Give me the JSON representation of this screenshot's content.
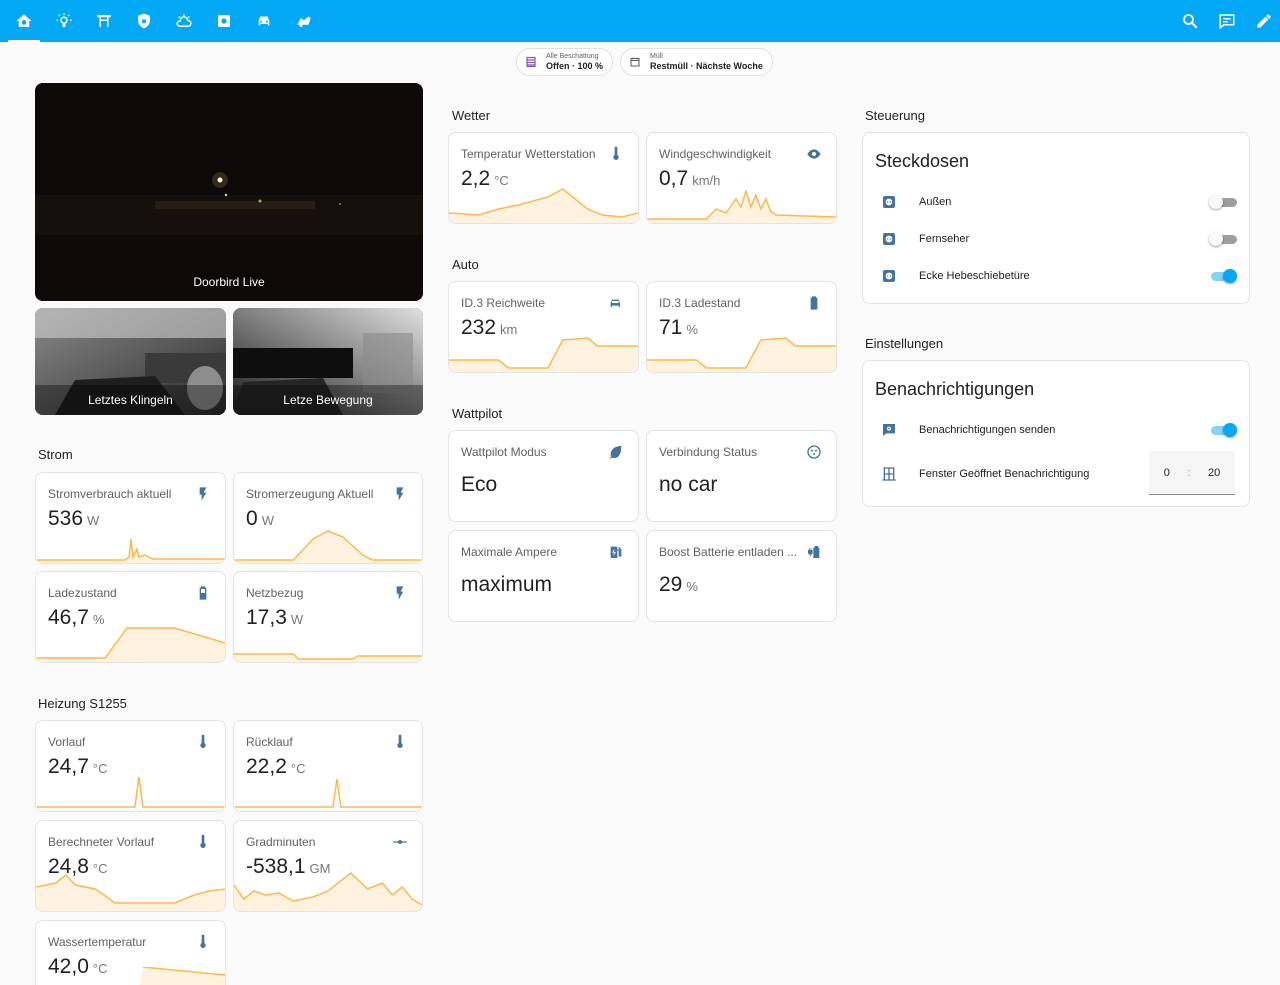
{
  "nav": {
    "tabs": [
      {
        "name": "home-icon"
      },
      {
        "name": "lightbulb-icon"
      },
      {
        "name": "gate-icon"
      },
      {
        "name": "shield-icon"
      },
      {
        "name": "weather-icon"
      },
      {
        "name": "appliance-icon"
      },
      {
        "name": "car-icon"
      },
      {
        "name": "robot-mower-icon"
      }
    ],
    "actions": [
      {
        "name": "search-icon"
      },
      {
        "name": "assist-icon"
      },
      {
        "name": "edit-icon"
      }
    ]
  },
  "chips": {
    "blinds": {
      "line1": "Alle Beschattung",
      "line2": "Offen · 100 %"
    },
    "trash": {
      "line1": "Müll",
      "line2": "Restmüll · Nächste Woche"
    }
  },
  "cameras": {
    "live": "Doorbird Live",
    "ring": "Letztes Klingeln",
    "motion": "Letze Bewegung"
  },
  "sections": {
    "strom": "Strom",
    "heizung": "Heizung S1255",
    "wetter": "Wetter",
    "auto": "Auto",
    "wattpilot": "Wattpilot",
    "steuerung": "Steuerung",
    "einstellungen": "Einstellungen"
  },
  "strom": {
    "verbrauch": {
      "name": "Stromverbrauch aktuell",
      "value": "536",
      "unit": "W"
    },
    "erzeugung": {
      "name": "Stromerzeugung Aktuell",
      "value": "0",
      "unit": "W"
    },
    "ladezustand": {
      "name": "Ladezustand",
      "value": "46,7",
      "unit": "%"
    },
    "netzbezug": {
      "name": "Netzbezug",
      "value": "17,3",
      "unit": "W"
    }
  },
  "heizung": {
    "vorlauf": {
      "name": "Vorlauf",
      "value": "24,7",
      "unit": "°C"
    },
    "ruecklauf": {
      "name": "Rücklauf",
      "value": "22,2",
      "unit": "°C"
    },
    "berechnet": {
      "name": "Berechneter Vorlauf",
      "value": "24,8",
      "unit": "°C"
    },
    "gradminuten": {
      "name": "Gradminuten",
      "value": "-538,1",
      "unit": "GM"
    },
    "wasser": {
      "name": "Wassertemperatur",
      "value": "42,0",
      "unit": "°C"
    }
  },
  "wetter": {
    "temp": {
      "name": "Temperatur Wetterstation",
      "value": "2,2",
      "unit": "°C"
    },
    "wind": {
      "name": "Windgeschwindigkeit",
      "value": "0,7",
      "unit": "km/h"
    }
  },
  "auto": {
    "reichweite": {
      "name": "ID.3 Reichweite",
      "value": "232",
      "unit": "km"
    },
    "ladestand": {
      "name": "ID.3 Ladestand",
      "value": "71",
      "unit": "%"
    }
  },
  "wattpilot": {
    "modus": {
      "name": "Wattpilot Modus",
      "value": "Eco"
    },
    "status": {
      "name": "Verbindung Status",
      "value": "no car"
    },
    "ampere": {
      "name": "Maximale Ampere",
      "value": "maximum"
    },
    "boost": {
      "name": "Boost Batterie entladen ...",
      "value": "29",
      "unit": "%"
    }
  },
  "steckdosen": {
    "title": "Steckdosen",
    "items": [
      {
        "label": "Außen",
        "on": false
      },
      {
        "label": "Fernseher",
        "on": false
      },
      {
        "label": "Ecke Hebeschiebetüre",
        "on": true
      }
    ]
  },
  "benachrichtigungen": {
    "title": "Benachrichtigungen",
    "send": {
      "label": "Benachrichtigungen senden",
      "on": true
    },
    "fenster": {
      "label": "Fenster Geöffnet Benachrichtigung",
      "hours": "0",
      "minutes": "20"
    }
  },
  "colors": {
    "primary": "#03a9f4",
    "spark": "#ffb74d",
    "sparkFill": "#fff3e0",
    "icon": "#44739e"
  }
}
